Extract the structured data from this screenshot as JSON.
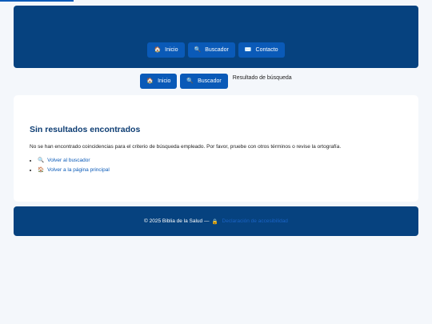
{
  "header": {
    "nav": [
      {
        "icon": "🏠",
        "label": "Inicio"
      },
      {
        "icon": "🔍",
        "label": "Buscador"
      },
      {
        "icon": "✉️",
        "label": "Contacto"
      }
    ]
  },
  "breadcrumb": {
    "items": [
      {
        "icon": "🏠",
        "label": "Inicio"
      },
      {
        "icon": "🔍",
        "label": "Buscador"
      }
    ],
    "current": "Resultado de búsqueda"
  },
  "main": {
    "title": "Sin resultados encontrados",
    "message": "No se han encontrado coincidencias para el criterio de búsqueda empleado. Por favor, pruebe con otros términos o revise la ortografía.",
    "links": [
      {
        "icon": "🔍",
        "label": "Volver al buscador"
      },
      {
        "icon": "🏠",
        "label": "Volver a la página principal"
      }
    ]
  },
  "footer": {
    "copyright": "© 2025 Biblia de la Salud —",
    "lock_icon": "🔒",
    "accessibility_link": "Declaración de accesibilidad"
  },
  "colors": {
    "header_bg": "#06427f",
    "button_bg": "#0a5ab8",
    "page_bg": "#f4f7fb",
    "title": "#0d3d73"
  }
}
